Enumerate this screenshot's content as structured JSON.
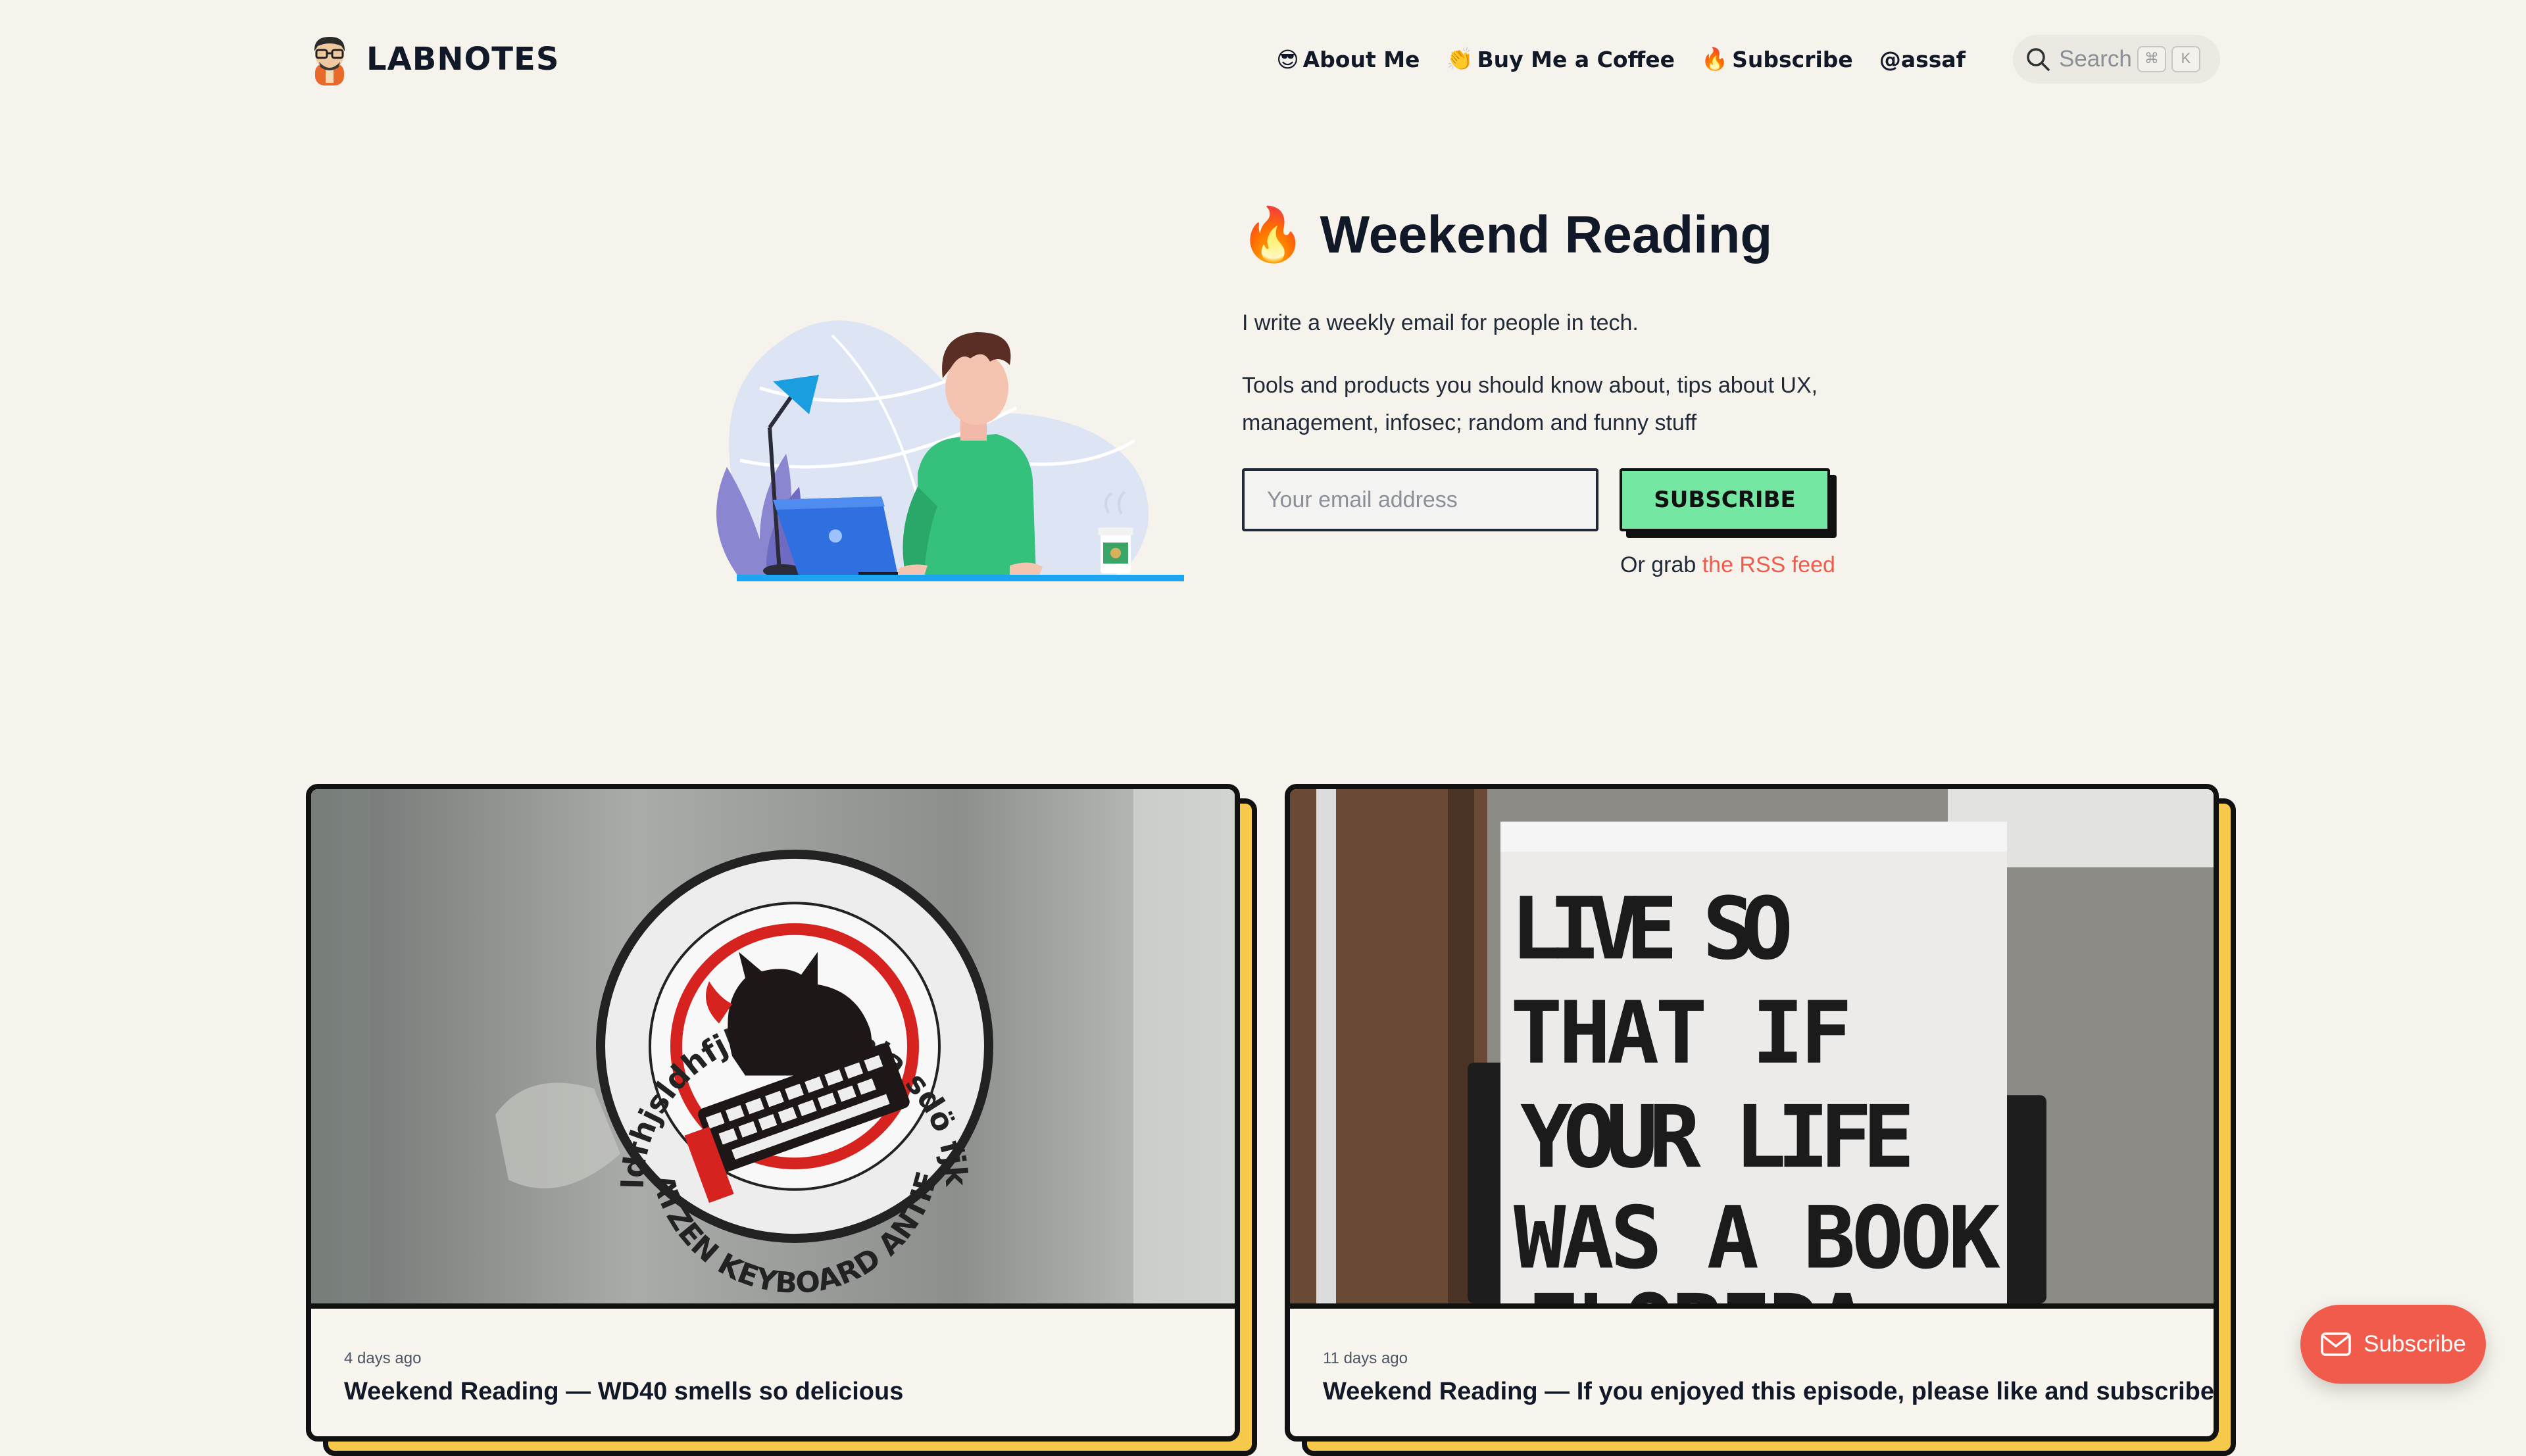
{
  "header": {
    "brand": "LABNOTES",
    "nav": [
      {
        "icon": "😎",
        "label": "About Me"
      },
      {
        "icon": "👏",
        "label": "Buy Me a Coffee"
      },
      {
        "icon": "🔥",
        "label": "Subscribe"
      },
      {
        "icon": "",
        "label": "@assaf"
      }
    ],
    "search": {
      "label": "Search",
      "shortcut": [
        "⌘",
        "K"
      ]
    }
  },
  "hero": {
    "title_icon": "🔥",
    "title": "Weekend Reading",
    "intro": "I write a weekly email for people in tech.",
    "description": "Tools and products you should know about, tips about UX, management, infosec; random and funny stuff",
    "email_placeholder": "Your email address",
    "subscribe_label": "SUBSCRIBE",
    "rss_prefix": "Or grab ",
    "rss_link": "the RSS feed"
  },
  "posts": [
    {
      "date": "4 days ago",
      "title": "Weekend Reading — WD40 smells so delicious",
      "image": {
        "sticker_top": "sldfhjsldhfjha sdljfnla sdö fjka",
        "sticker_bottom": "KATZEN KEYBOARD ANTIFA"
      }
    },
    {
      "date": "11 days ago",
      "title": "Weekend Reading — If you enjoyed this episode, please like and subscribe",
      "image": {
        "sign_lines": [
          "LIVE SO",
          "THAT IF",
          "YOUR LIFE",
          "WAS A BOOK",
          "FLORIDA"
        ]
      }
    }
  ],
  "floating_subscribe": {
    "label": "Subscribe"
  },
  "colors": {
    "background": "#f6f3ec",
    "accent_green": "#74e8a3",
    "accent_red": "#f05b4b",
    "card_shadow": "#f7c94a"
  }
}
